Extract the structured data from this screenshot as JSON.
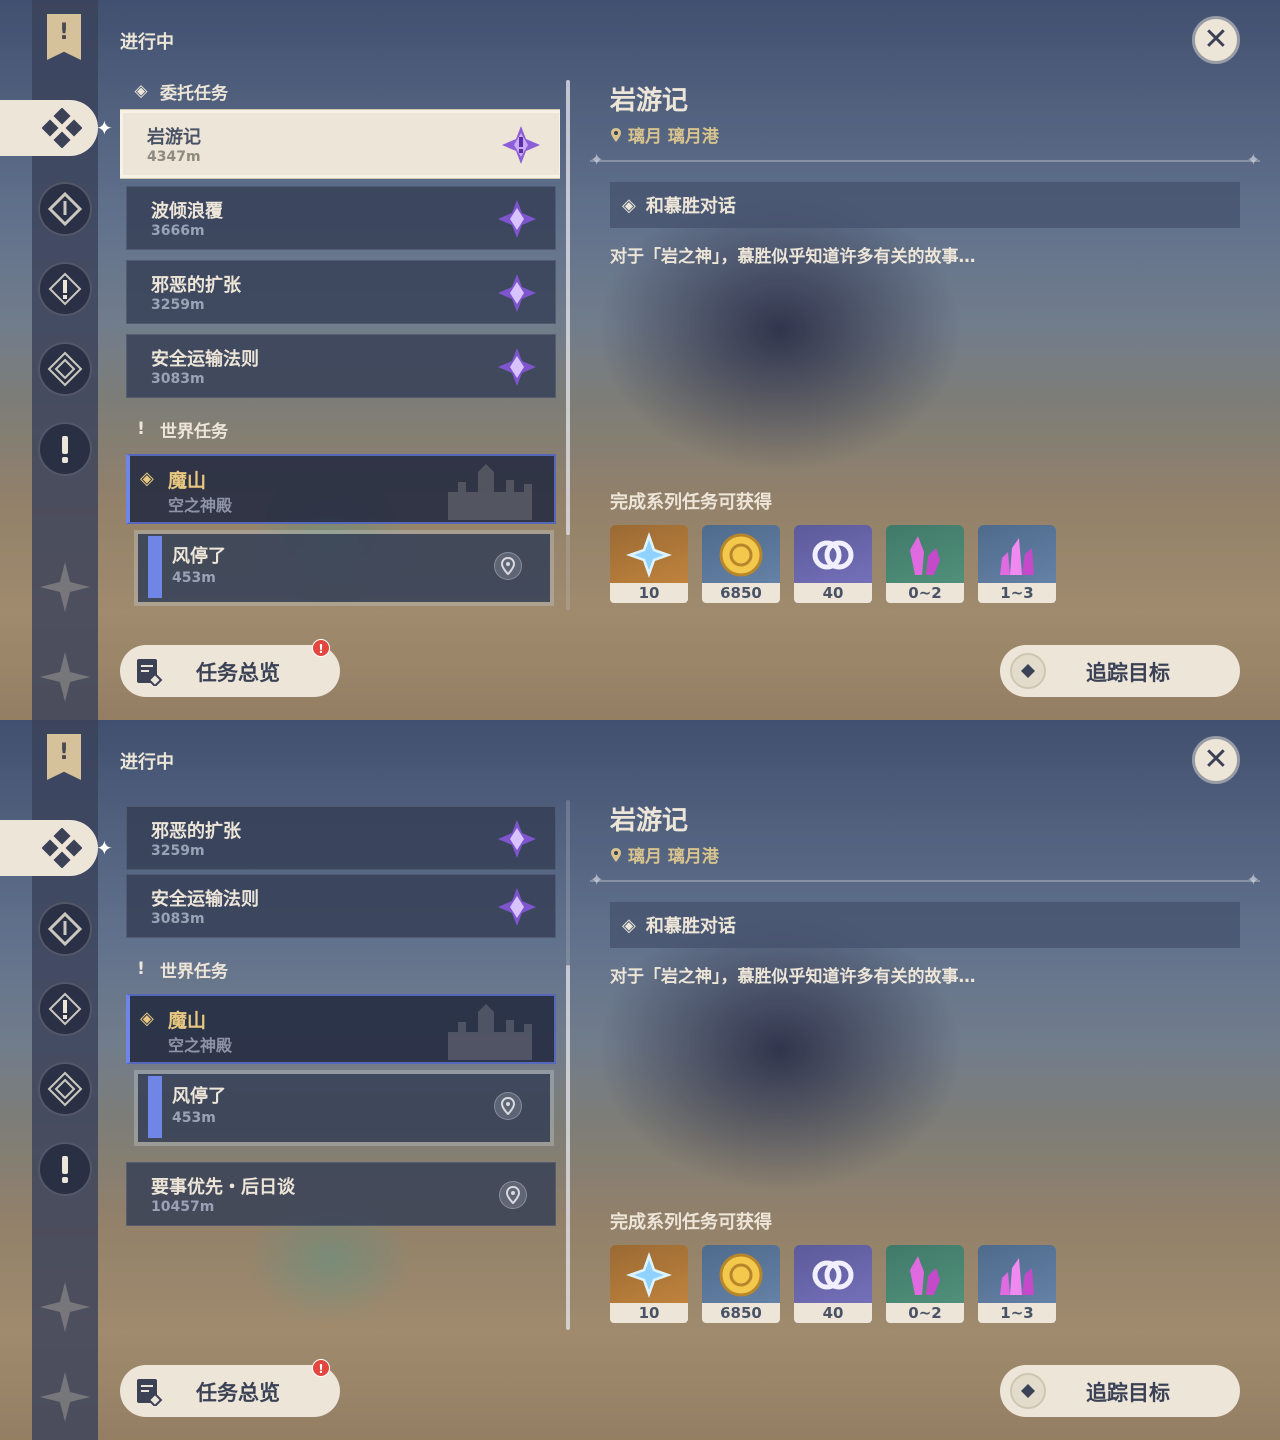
{
  "header": {
    "in_progress": "进行中"
  },
  "sections": {
    "commission": "委托任务",
    "world": "世界任务"
  },
  "quests": {
    "yanyouji": {
      "name": "岩游记",
      "dist": "4347m"
    },
    "boqing": {
      "name": "波倾浪覆",
      "dist": "3666m"
    },
    "xiee": {
      "name": "邪恶的扩张",
      "dist": "3259m"
    },
    "anquan": {
      "name": "安全运输法则",
      "dist": "3083m"
    },
    "moshan": {
      "name": "魔山",
      "dist": "空之神殿"
    },
    "fengting": {
      "name": "风停了",
      "dist": "453m"
    },
    "yaoshi": {
      "name": "要事优先・后日谈",
      "dist": "10457m"
    }
  },
  "detail": {
    "title": "岩游记",
    "location": "璃月 璃月港",
    "objective": "和慕胜对话",
    "description": "对于「岩之神」，慕胜似乎知道许多有关的故事…",
    "reward_label": "完成系列任务可获得",
    "rewards": [
      {
        "icon": "primogem-icon",
        "count": "10"
      },
      {
        "icon": "mora-icon",
        "count": "6850"
      },
      {
        "icon": "friendship-exp-icon",
        "count": "40"
      },
      {
        "icon": "crystal-chunk-icon",
        "count": "0~2"
      },
      {
        "icon": "crystal-cluster-icon",
        "count": "1~3"
      }
    ]
  },
  "buttons": {
    "overview": "任务总览",
    "overview_badge": "!",
    "track": "追踪目标"
  },
  "colors": {
    "panel_cream": "#ece5d8",
    "world_quest_gold": "#e8c880",
    "world_quest_accent": "#6f86e6",
    "location_gold": "#d8c38e",
    "badge_red": "#e2463f"
  }
}
